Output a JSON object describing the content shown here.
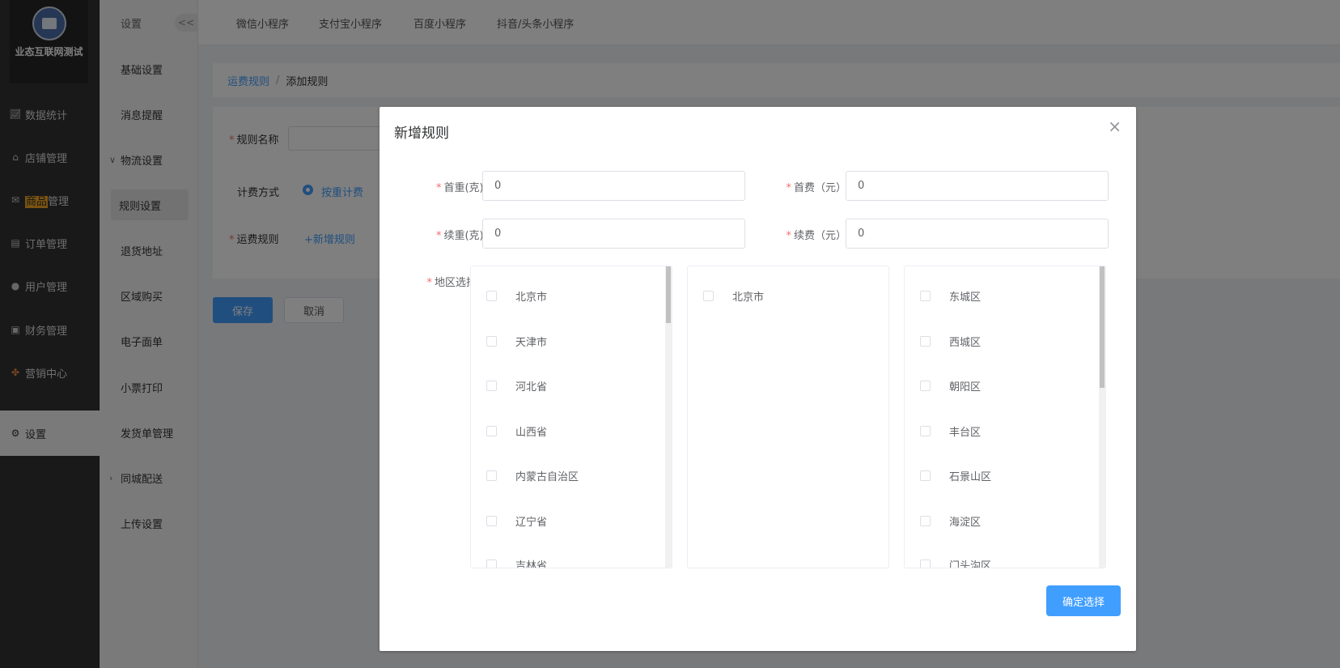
{
  "brand": {
    "name": "业态互联网测试"
  },
  "nav": {
    "items": [
      {
        "label": "数据统计",
        "icon": "chart-icon"
      },
      {
        "label": "店铺管理",
        "icon": "shop-icon"
      },
      {
        "label_hl": "商品",
        "label_rest": "管理",
        "icon": "goods-icon"
      },
      {
        "label": "订单管理",
        "icon": "order-icon"
      },
      {
        "label": "用户管理",
        "icon": "user-icon"
      },
      {
        "label": "财务管理",
        "icon": "finance-icon"
      },
      {
        "label": "营销中心",
        "icon": "marketing-icon"
      },
      {
        "label": "设置",
        "icon": "gear-icon"
      }
    ]
  },
  "subnav": {
    "title": "设置",
    "collapse": "<<",
    "items": [
      "基础设置",
      "消息提醒",
      "物流设置",
      "规则设置",
      "退货地址",
      "区域购买",
      "电子面单",
      "小票打印",
      "发货单管理",
      "同城配送",
      "上传设置"
    ]
  },
  "topbar": {
    "tabs": [
      "微信小程序",
      "支付宝小程序",
      "百度小程序",
      "抖音/头条小程序"
    ]
  },
  "breadcrumb": {
    "parent": "运费规则",
    "sep": "/",
    "current": "添加规则"
  },
  "form": {
    "rule_name_label": "规则名称",
    "billing_label": "计费方式",
    "billing_option": "按重计费",
    "freight_rule_label": "运费规则",
    "add_rule": "+新增规则",
    "save": "保存",
    "cancel": "取消"
  },
  "dialog": {
    "title": "新增规则",
    "close": "×",
    "first_weight_label": "首重(克):",
    "first_weight_value": "0",
    "first_fee_label": "首费（元）",
    "first_fee_value": "0",
    "extra_weight_label": "续重(克):",
    "extra_weight_value": "0",
    "extra_fee_label": "续费（元）",
    "extra_fee_value": "0",
    "region_label": "地区选择",
    "provinces": [
      "北京市",
      "天津市",
      "河北省",
      "山西省",
      "内蒙古自治区",
      "辽宁省",
      "吉林省"
    ],
    "cities": [
      "北京市"
    ],
    "districts": [
      "东城区",
      "西城区",
      "朝阳区",
      "丰台区",
      "石景山区",
      "海淀区",
      "门头沟区"
    ],
    "confirm": "确定选择"
  },
  "colors": {
    "accent": "#409eff",
    "nav_bg": "#333333",
    "required": "#f56c6c"
  }
}
